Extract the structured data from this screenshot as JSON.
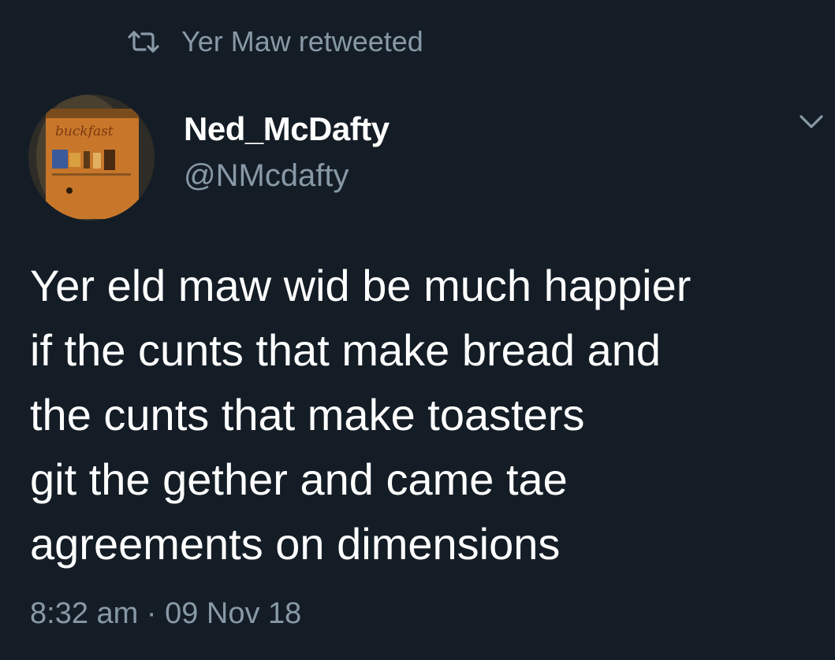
{
  "retweet": {
    "icon": "retweet-icon",
    "text": "Yer Maw retweeted"
  },
  "author": {
    "display_name": "Ned_McDafty",
    "handle": "@NMcdafty",
    "avatar_label": "buckfast"
  },
  "menu": {
    "icon": "chevron-down-icon"
  },
  "tweet": {
    "lines": [
      "Yer eld maw wid be much happier",
      "if the cunts that make bread and",
      "the cunts that make toasters",
      "git the gether and came tae",
      "agreements on dimensions"
    ],
    "timestamp": "8:32 am · 09 Nov 18"
  },
  "colors": {
    "background": "#141d26",
    "text": "#ffffff",
    "secondary_text": "#8899a6"
  }
}
